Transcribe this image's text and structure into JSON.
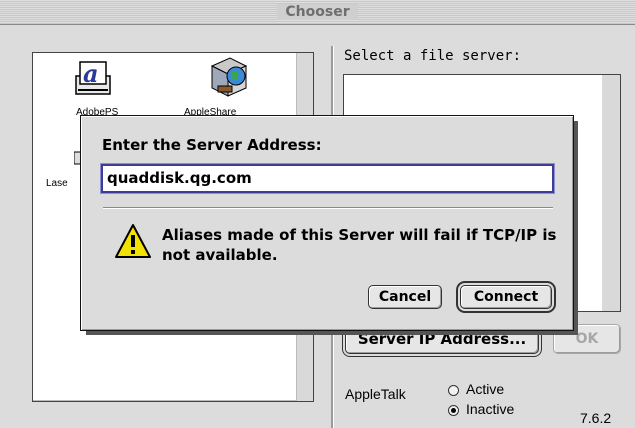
{
  "window": {
    "title": "Chooser",
    "version": "7.6.2"
  },
  "drivers": {
    "items": [
      {
        "label": "AdobePS",
        "icon": "adobeps-printer-icon"
      },
      {
        "label": "AppleShare",
        "icon": "appleshare-server-icon"
      },
      {
        "label": "Lase",
        "icon": "laserwriter-printer-icon"
      }
    ]
  },
  "server_panel": {
    "label": "Select a file server:",
    "server_ip_button": "Server IP Address...",
    "ok_button": "OK"
  },
  "appletalk": {
    "label": "AppleTalk",
    "options": [
      {
        "label": "Active",
        "selected": false
      },
      {
        "label": "Inactive",
        "selected": true
      }
    ]
  },
  "dialog": {
    "prompt": "Enter the Server Address:",
    "address_value": "quaddisk.qg.com",
    "warning_icon": "warning-triangle-icon",
    "warning_text": "Aliases made of this Server will fail if TCP/IP is not available.",
    "cancel_button": "Cancel",
    "connect_button": "Connect"
  },
  "colors": {
    "focus_ring": "#3d3d98",
    "warning_yellow": "#f2e200"
  }
}
